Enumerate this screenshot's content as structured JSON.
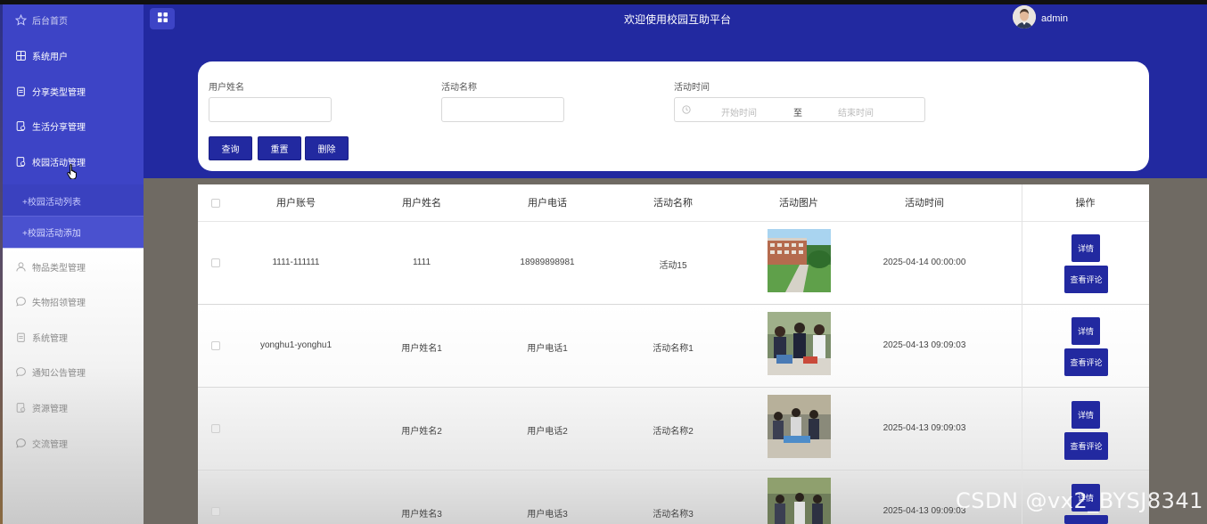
{
  "header": {
    "title": "欢迎使用校园互助平台",
    "username": "admin"
  },
  "sidebar": {
    "items": [
      {
        "label": "后台首页",
        "icon": "star-icon"
      },
      {
        "label": "系统用户",
        "icon": "grid-icon"
      },
      {
        "label": "分享类型管理",
        "icon": "clipboard-icon"
      },
      {
        "label": "生活分享管理",
        "icon": "doc-gear-icon"
      },
      {
        "label": "校园活动管理",
        "icon": "doc-gear-icon"
      },
      {
        "label": "物品类型管理",
        "icon": "user-icon"
      },
      {
        "label": "失物招领管理",
        "icon": "chat-icon"
      },
      {
        "label": "系统管理",
        "icon": "clipboard-icon"
      },
      {
        "label": "通知公告管理",
        "icon": "chat-icon"
      },
      {
        "label": "资源管理",
        "icon": "doc-gear-icon"
      },
      {
        "label": "交流管理",
        "icon": "chat-icon"
      }
    ],
    "subitems": [
      {
        "label": "+校园活动列表"
      },
      {
        "label": "+校园活动添加"
      }
    ]
  },
  "search": {
    "username_label": "用户姓名",
    "activity_name_label": "活动名称",
    "activity_time_label": "活动时间",
    "start_placeholder": "开始时间",
    "range_separator": "至",
    "end_placeholder": "结束时间",
    "query_button": "查询",
    "reset_button": "重置",
    "delete_button": "删除"
  },
  "table": {
    "columns": [
      "用户账号",
      "用户姓名",
      "用户电话",
      "活动名称",
      "活动图片",
      "活动时间",
      "操作"
    ],
    "rows": [
      {
        "account": "1111-111111",
        "name": "1111",
        "phone": "18989898981",
        "activity": "活动15",
        "time": "2025-04-14 00:00:00"
      },
      {
        "account": "yonghu1-yonghu1",
        "name": "用户姓名1",
        "phone": "用户电话1",
        "activity": "活动名称1",
        "time": "2025-04-13 09:09:03"
      },
      {
        "account": "",
        "name": "用户姓名2",
        "phone": "用户电话2",
        "activity": "活动名称2",
        "time": "2025-04-13 09:09:03"
      },
      {
        "account": "",
        "name": "用户姓名3",
        "phone": "用户电话3",
        "activity": "活动名称3",
        "time": "2025-04-13 09:09:03"
      }
    ],
    "detail_button": "详情",
    "comments_button": "查看评论"
  },
  "watermark": "CSDN @vx2_BYSJ8341",
  "colors": {
    "primary": "#2229a0",
    "sidebar": "#3d44c6"
  }
}
